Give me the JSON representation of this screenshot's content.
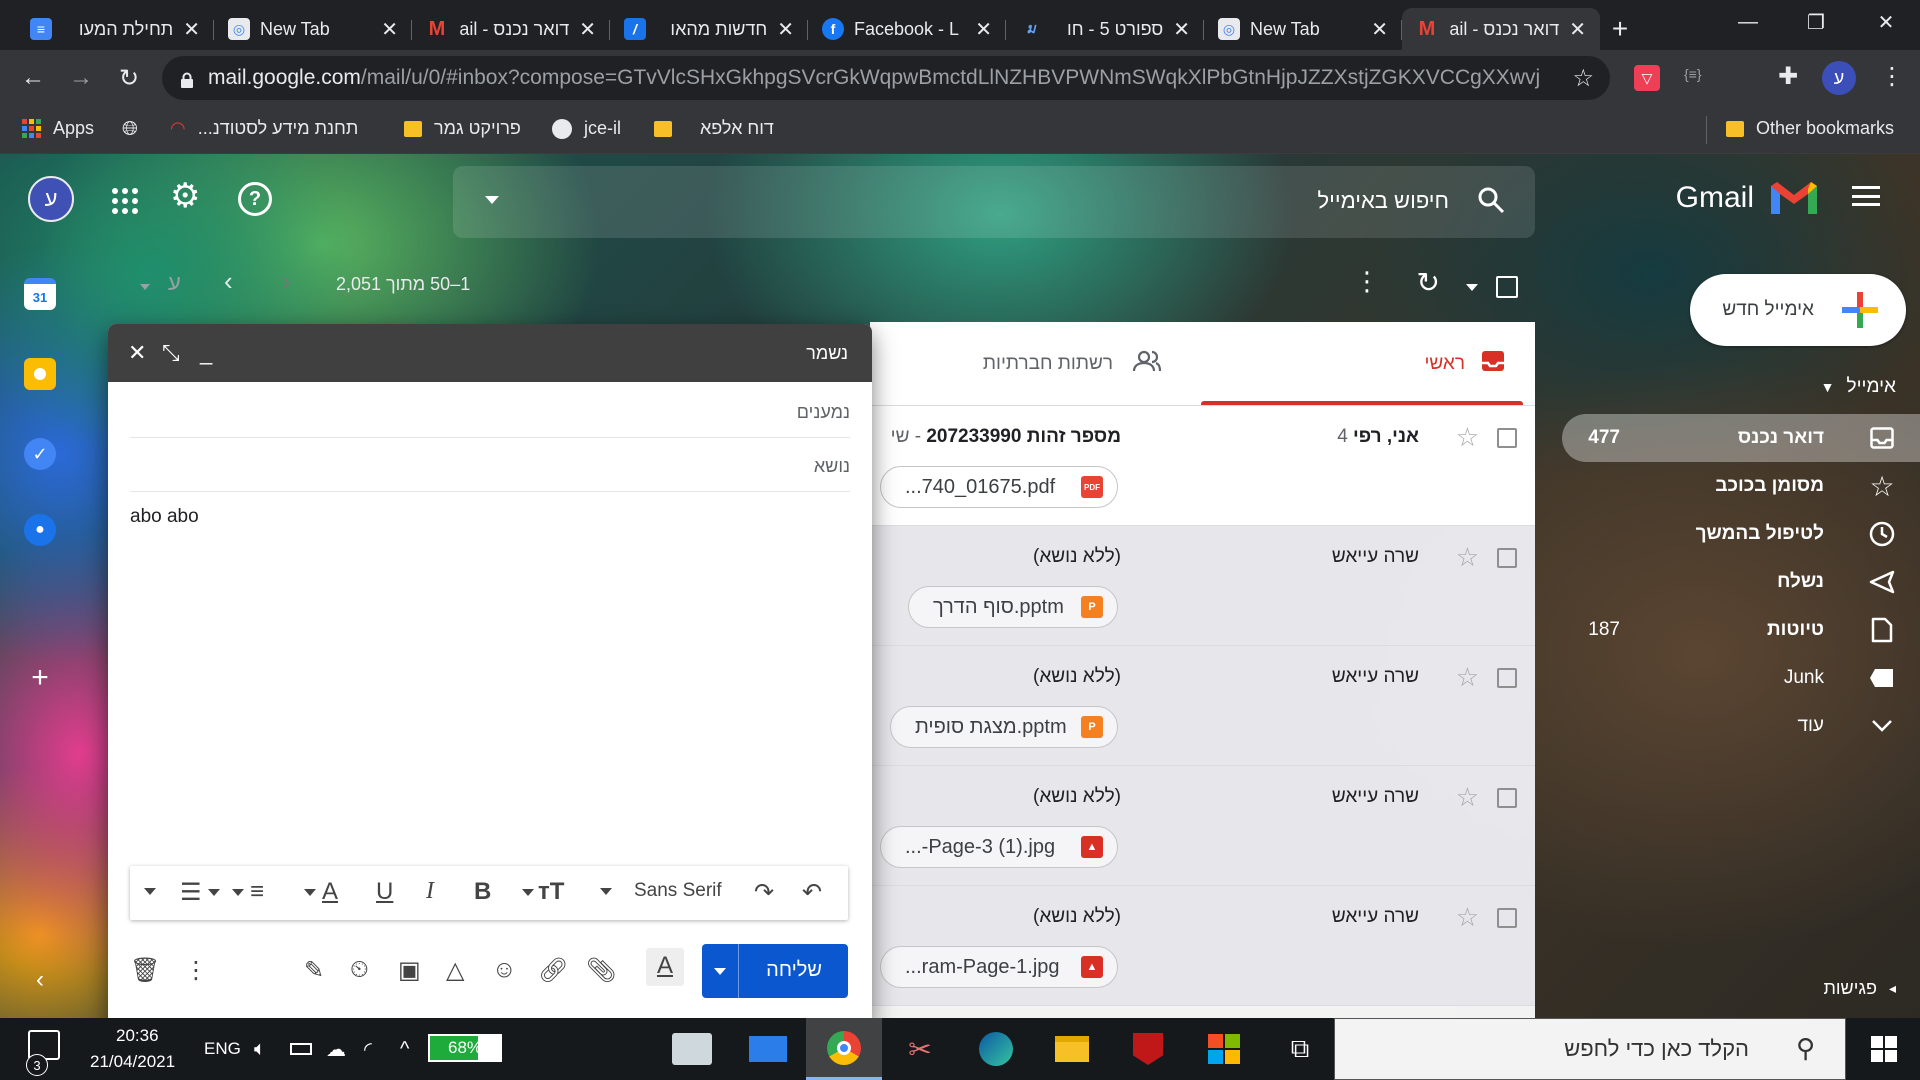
{
  "browser": {
    "tabs": [
      {
        "title": "תחילת המעו",
        "icon": "docs-icon",
        "color": "#4285f4"
      },
      {
        "title": "New Tab",
        "icon": "chrome-newtab-icon",
        "color": "#e8eaed"
      },
      {
        "title": "דואר נכנס - ail",
        "icon": "gmail-icon",
        "color": "#ffffff"
      },
      {
        "title": "חדשות מהאו",
        "icon": "news-icon",
        "color": "#1a73e8"
      },
      {
        "title": "Facebook - L",
        "icon": "facebook-icon",
        "color": "#1877f2"
      },
      {
        "title": "ספורט 5 - חו",
        "icon": "sport5-icon",
        "color": "#2563eb"
      },
      {
        "title": "New Tab",
        "icon": "chrome-newtab-icon",
        "color": "#e8eaed"
      },
      {
        "title": "דואר נכנס - ail",
        "icon": "gmail-icon",
        "color": "#ffffff"
      }
    ],
    "new_tab": "+",
    "url_host": "mail.google.com",
    "url_rest": "/mail/u/0/#inbox?compose=GTvVlcSHxGkhpgSVcrGkWqpwBmctdLlNZHBVPWNmSWqkXlPbGtnHjpJZZXstjZGKXVCCgXXwvjDnG",
    "profile_initial": "ע",
    "bookmarks": [
      {
        "label": "Apps",
        "icon": "apps-grid-icon"
      },
      {
        "label": "",
        "icon": "globe-icon"
      },
      {
        "label": "תחנת מידע לסטודנ...",
        "icon": "bookmark-red-icon"
      },
      {
        "label": "פרויקט גמר",
        "icon": "folder-icon"
      },
      {
        "label": "jce-il",
        "icon": "github-icon"
      },
      {
        "label": "דוח אלפא",
        "icon": "folder-icon"
      }
    ],
    "other_bookmarks": "Other bookmarks"
  },
  "gmail": {
    "brand": "Gmail",
    "search_placeholder": "חיפוש באימייל",
    "account_initial": "ע",
    "compose_label": "אימייל חדש",
    "section_label": "אימייל",
    "nav": [
      {
        "label": "דואר נכנס",
        "count": "477",
        "icon": "inbox-icon",
        "selected": true
      },
      {
        "label": "מסומן בכוכב",
        "count": "",
        "icon": "star-icon",
        "selected": false
      },
      {
        "label": "לטיפול בהמשך",
        "count": "",
        "icon": "clock-icon",
        "selected": false
      },
      {
        "label": "נשלח",
        "count": "",
        "icon": "send-icon",
        "selected": false
      },
      {
        "label": "טיוטות",
        "count": "187",
        "icon": "draft-icon",
        "selected": false
      },
      {
        "label": "Junk",
        "count": "",
        "icon": "label-icon",
        "selected": false
      },
      {
        "label": "עוד",
        "count": "",
        "icon": "chevron-down-icon",
        "selected": false
      }
    ],
    "meetings_label": "פגישות",
    "range_text": "1–50 מתוך 2,051",
    "input_tool": "ע",
    "categories": [
      {
        "label": "ראשי",
        "icon": "inbox-icon",
        "active": true
      },
      {
        "label": "רשתות חברתיות",
        "icon": "people-icon",
        "active": false
      }
    ],
    "emails": [
      {
        "sender": "אני, רפי",
        "sender_count": "4",
        "subject": "מספר זהות 207233990",
        "snippet": " - שי",
        "attachment": "...740_01675.pdf",
        "file_type": "PDF",
        "file_color": "#ea4335",
        "unread": true
      },
      {
        "sender": "שרה עייאש",
        "sender_count": "",
        "subject": "(ללא נושא)",
        "snippet": "",
        "attachment": "סוף הדרך.pptm",
        "file_type": "P",
        "file_color": "#f4801f",
        "unread": false
      },
      {
        "sender": "שרה עייאש",
        "sender_count": "",
        "subject": "(ללא נושא)",
        "snippet": "",
        "attachment": "מצגת סופית.pptm",
        "file_type": "P",
        "file_color": "#f4801f",
        "unread": false
      },
      {
        "sender": "שרה עייאש",
        "sender_count": "",
        "subject": "(ללא נושא)",
        "snippet": "",
        "attachment": "...-Page-3 (1).jpg",
        "file_type": "IMG",
        "file_color": "#d93025",
        "unread": false
      },
      {
        "sender": "שרה עייאש",
        "sender_count": "",
        "subject": "(ללא נושא)",
        "snippet": "",
        "attachment": "...ram-Page-1.jpg",
        "file_type": "IMG",
        "file_color": "#d93025",
        "unread": false
      }
    ]
  },
  "compose": {
    "title": "נשמר",
    "recipients_placeholder": "נמענים",
    "subject_placeholder": "נושא",
    "body": "abo abo",
    "font_name": "Sans Serif",
    "send_label": "שליחה"
  },
  "taskbar": {
    "search_placeholder": "הקלד כאן כדי לחפש",
    "battery": "68%",
    "language": "ENG",
    "time": "20:36",
    "date": "21/04/2021",
    "notifications": "3"
  }
}
